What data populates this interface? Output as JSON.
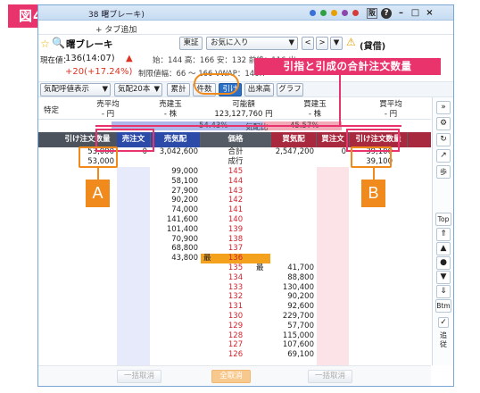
{
  "figure_label": "図4",
  "window": {
    "title": "38 曙ブレーキ)",
    "tab_add": "+ タブ追加",
    "controls": [
      "?",
      "–",
      "□",
      "×"
    ],
    "dot_colors": [
      "#3a6fd8",
      "#2ea043",
      "#e6a100",
      "#8e44ad",
      "#d63b3b"
    ]
  },
  "header": {
    "stock_name": "曙ブレーキ",
    "market": "東証",
    "favorites": "お気に入り",
    "lending": "(貸借)",
    "current_label": "現在値：",
    "current_price": "136(14:07)",
    "change": "+20(+17.24%)",
    "stats_line1": "始：144  高：166  安：132  前終：116  出",
    "stats_line2": "制限値幅：66 ～ 166  VWAP：146.7"
  },
  "toolbar": {
    "price_mode": "気配呼値表示",
    "depth": "気配20本",
    "buttons": [
      "累計",
      "件数",
      "引け",
      "出来高",
      "グラフ"
    ],
    "active_button": "引け"
  },
  "summary": {
    "col1_label": "特定",
    "sell_avg_label": "売平均",
    "sell_avg_value": "- 円",
    "sell_pos_label": "売建玉",
    "sell_pos_value": "- 株",
    "avail_label": "可能額",
    "avail_value": "123,127,760 円",
    "buy_pos_label": "買建玉",
    "buy_pos_value": "- 株",
    "buy_avg_label": "買平均",
    "buy_avg_value": "- 円"
  },
  "ratio_bar": {
    "left": "54.43%",
    "middle": "気配比",
    "right": "45.57%",
    "left_fraction": 0.5443
  },
  "columns": {
    "close_sell": "引け注文数量",
    "sell_order": "売注文",
    "sell_quote": "売気配",
    "price": "価格",
    "buy_quote": "買気配",
    "buy_order": "買注文",
    "close_buy": "引け注文数量"
  },
  "rows_top": {
    "total_label": "合計",
    "market_label": "成行",
    "close_sell_total": "53,000",
    "close_sell_market": "53,000",
    "sell_order_total": "0",
    "sell_quote_total": "3,042,600",
    "buy_quote_total": "2,547,200",
    "buy_order_total": "0",
    "close_buy_total": "39,100",
    "close_buy_market": "39,100"
  },
  "sell_rows": [
    {
      "qty": "99,000",
      "price": "145"
    },
    {
      "qty": "58,100",
      "price": "144"
    },
    {
      "qty": "27,900",
      "price": "143"
    },
    {
      "qty": "90,200",
      "price": "142"
    },
    {
      "qty": "74,000",
      "price": "141"
    },
    {
      "qty": "141,600",
      "price": "140"
    },
    {
      "qty": "101,400",
      "price": "139"
    },
    {
      "qty": "70,900",
      "price": "138"
    },
    {
      "qty": "68,800",
      "price": "137"
    },
    {
      "qty": "43,800",
      "price": "136",
      "mark": "最"
    }
  ],
  "buy_rows": [
    {
      "price": "135",
      "qty": "41,700",
      "mark": "最"
    },
    {
      "price": "134",
      "qty": "88,800"
    },
    {
      "price": "133",
      "qty": "130,400"
    },
    {
      "price": "132",
      "qty": "90,200"
    },
    {
      "price": "131",
      "qty": "92,600"
    },
    {
      "price": "130",
      "qty": "229,700"
    },
    {
      "price": "129",
      "qty": "57,700"
    },
    {
      "price": "128",
      "qty": "115,000"
    },
    {
      "price": "127",
      "qty": "107,600"
    },
    {
      "price": "126",
      "qty": "69,100"
    }
  ],
  "bottom": {
    "cancel_all_sell": "一括取消",
    "cancel_everything": "全取消",
    "cancel_all_buy": "一括取消"
  },
  "sidebar": {
    "top": "Top",
    "btm": "Btm",
    "follow": "追従"
  },
  "annotations": {
    "callout": "引指と引成の合計注文数量",
    "badge_a": "A",
    "badge_b": "B"
  }
}
